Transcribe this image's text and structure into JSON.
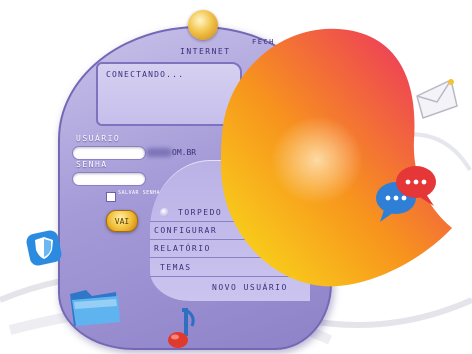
{
  "window": {
    "internet_label": "INTERNET",
    "close_label": "FECH",
    "status_text": "CONECTANDO...",
    "user_label": "USUÁRIO",
    "password_label": "SENHA",
    "domain_suffix": "OM.BR",
    "save_password_label": "SALVAR SENHA",
    "go_button": "VAI"
  },
  "menu": {
    "items": [
      "TORPEDO",
      "CONFIGURAR",
      "RELATÓRIO",
      "TEMAS"
    ],
    "new_user": "NOVO USUÁRIO"
  },
  "icons": [
    "shield-icon",
    "folder-icon",
    "music-note-icon",
    "mail-icon",
    "chat-bubbles-icon"
  ],
  "colors": {
    "window": "#a59bd8",
    "button": "#f0bb34",
    "logo_start": "#f9e21a",
    "logo_end": "#e2237d"
  }
}
